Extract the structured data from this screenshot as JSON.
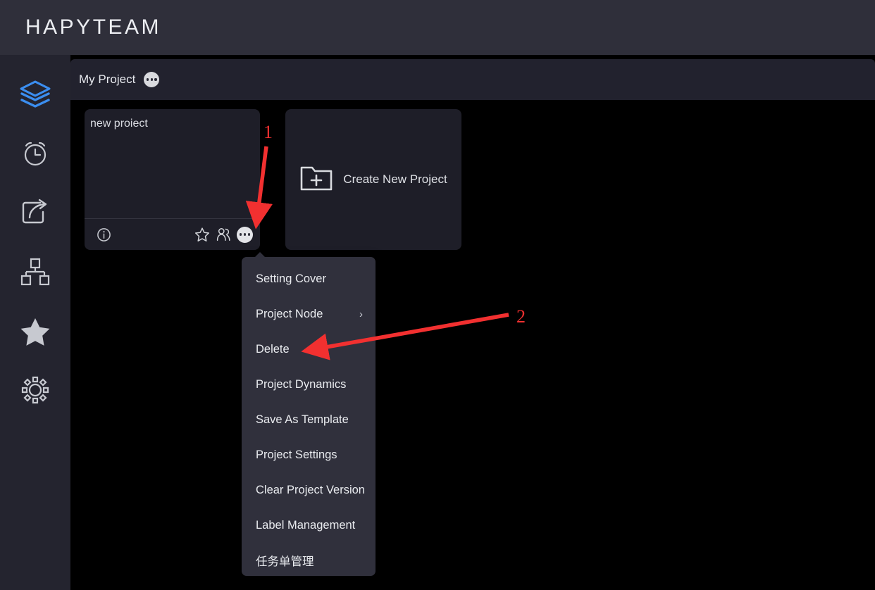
{
  "app": {
    "brand": "HAPYTEAM"
  },
  "sidebar": {
    "items": [
      {
        "icon": "layers-icon",
        "active": true
      },
      {
        "icon": "alarm-clock-icon",
        "active": false
      },
      {
        "icon": "share-export-icon",
        "active": false
      },
      {
        "icon": "sitemap-icon",
        "active": false
      },
      {
        "icon": "star-filled-icon",
        "active": false
      },
      {
        "icon": "gear-icon",
        "active": false
      }
    ],
    "active_color": "#3b8ef0",
    "inactive_color": "#c7c9d0"
  },
  "panel": {
    "title": "My Project",
    "more_icon": "ellipsis-icon"
  },
  "cards": {
    "project": {
      "title": "new proiect",
      "footer_icons": [
        "info-icon",
        "star-outline-icon",
        "people-icon",
        "ellipsis-icon"
      ]
    },
    "create": {
      "label": "Create New Project",
      "icon": "folder-plus-icon"
    }
  },
  "menu": {
    "items": [
      {
        "label": "Setting Cover",
        "submenu": false
      },
      {
        "label": "Project Node",
        "submenu": true
      },
      {
        "label": "Delete",
        "submenu": false
      },
      {
        "label": "Project Dynamics",
        "submenu": false
      },
      {
        "label": "Save As Template",
        "submenu": false
      },
      {
        "label": "Project Settings",
        "submenu": false
      },
      {
        "label": "Clear Project Version",
        "submenu": false
      },
      {
        "label": "Label Management",
        "submenu": false
      },
      {
        "label": "任务单管理",
        "submenu": false
      }
    ],
    "chevron_glyph": "›"
  },
  "annotations": {
    "color": "#f23030",
    "markers": [
      {
        "label": "1",
        "points_to": "project-card-ellipsis-button"
      },
      {
        "label": "2",
        "points_to": "menu-item-delete"
      }
    ]
  }
}
